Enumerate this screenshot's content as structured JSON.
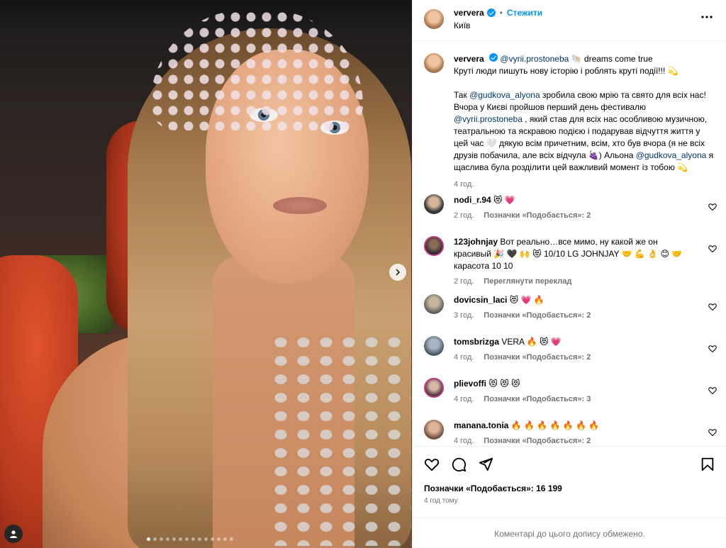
{
  "post": {
    "username": "ververa",
    "verified": true,
    "separator": "•",
    "follow_label": "Стежити",
    "location": "Київ"
  },
  "caption": {
    "username": "ververa",
    "mention1": "@vyrii.prostoneba",
    "line1_rest": "🐚 dreams come true",
    "line2": "Круті люди пишуть нову історію і роблять круті події!!! 💫",
    "p2_a": "Так ",
    "p2_mention1": "@gudkova_alyona",
    "p2_b": " зробила свою мрію та свято для всіх нас! Вчора у Києві пройшов перший день фестивалю ",
    "p2_mention2": "@vyrii.prostoneba",
    "p2_c": " , який став для всіх нас особливою музичною, театральною та яскравою подією і подарував відчуття життя у цей час 🤍  дякую всім причетним, всім, хто був вчора (я не всіх друзів побачила, але всіх відчула 🍇) Альона ",
    "p2_mention3": "@gudkova_alyona",
    "p2_d": " я щаслива була розділити цей важливий момент із тобою 💫",
    "time": "4 год."
  },
  "comments": [
    {
      "username": "nodi_r.94",
      "text": "😻 💗",
      "time": "2 год.",
      "likes": "Позначки «Подобається»: 2"
    },
    {
      "username": "123johnjay",
      "text": "Вот реально…все мимо, ну какой же он красивый 🎉 🖤 🙌 😻  10/10 LG JOHNJAY 🤝 💪 👌 😊 🤝 карасота 10 10",
      "time": "2 год.",
      "likes": "Переглянути переклад"
    },
    {
      "username": "dovicsin_laci",
      "text": "😻 💗 🔥",
      "time": "3 год.",
      "likes": "Позначки «Подобається»: 2"
    },
    {
      "username": "tomsbrizga",
      "text": "VERA 🔥 😻 💗",
      "time": "4 год.",
      "likes": "Позначки «Подобається»: 2"
    },
    {
      "username": "plievoffi",
      "text": "😻 😻 😻",
      "time": "4 год.",
      "likes": "Позначки «Подобається»: 3"
    },
    {
      "username": "manana.tonia",
      "text": "🔥 🔥 🔥 🔥 🔥 🔥 🔥",
      "time": "4 год.",
      "likes": "Позначки «Подобається»: 2"
    }
  ],
  "footer": {
    "likes": "Позначки «Подобається»: 16 199",
    "time": "4 год тому",
    "comments_limited": "Коментарі до цього допису обмежено."
  },
  "carousel": {
    "total_slides": 14,
    "active_index": 0
  },
  "colors": {
    "accent": "#0095f6",
    "mention": "#00376b",
    "muted": "#737373"
  }
}
